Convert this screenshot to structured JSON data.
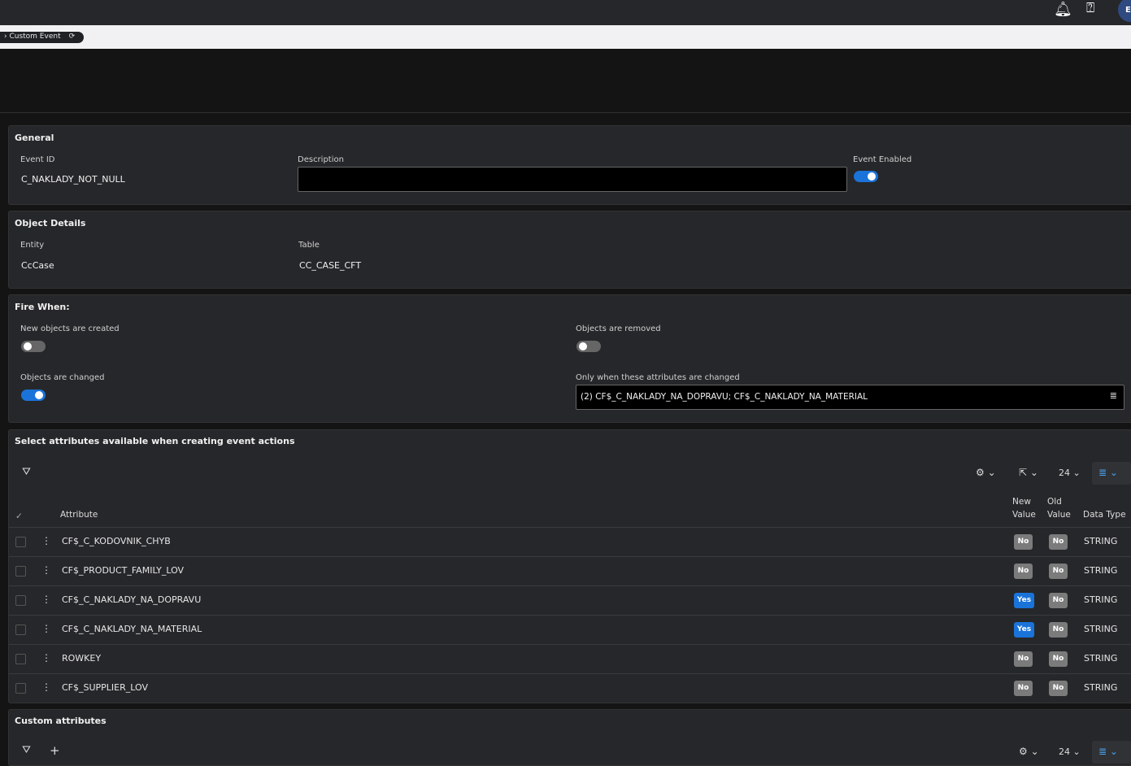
{
  "header": {
    "bell_icon": "bell-icon",
    "help_icon": "help-icon",
    "avatar_initial": "E"
  },
  "breadcrumb": {
    "label": "Custom Event"
  },
  "general": {
    "title": "General",
    "event_id_label": "Event ID",
    "event_id": "C_NAKLADY_NOT_NULL",
    "description_label": "Description",
    "description": "",
    "enabled_label": "Event Enabled",
    "enabled": true
  },
  "object_details": {
    "title": "Object Details",
    "entity_label": "Entity",
    "entity": "CcCase",
    "table_label": "Table",
    "table": "CC_CASE_CFT"
  },
  "fire_when": {
    "title": "Fire When:",
    "created_label": "New objects are created",
    "created": false,
    "removed_label": "Objects are removed",
    "removed": false,
    "changed_label": "Objects are changed",
    "changed": true,
    "only_when_label": "Only when these attributes are changed",
    "only_when_value": "(2) CF$_C_NAKLADY_NA_DOPRAVU; CF$_C_NAKLADY_NA_MATERIAL"
  },
  "attributes": {
    "title": "Select attributes available when creating event actions",
    "page_size": "24",
    "columns": {
      "attribute": "Attribute",
      "new_value": "New Value",
      "old_value": "Old Value",
      "data_type": "Data Type"
    },
    "rows": [
      {
        "name": "CF$_C_KODOVNIK_CHYB",
        "new": "No",
        "old": "No",
        "type": "STRING"
      },
      {
        "name": "CF$_PRODUCT_FAMILY_LOV",
        "new": "No",
        "old": "No",
        "type": "STRING"
      },
      {
        "name": "CF$_C_NAKLADY_NA_DOPRAVU",
        "new": "Yes",
        "old": "No",
        "type": "STRING"
      },
      {
        "name": "CF$_C_NAKLADY_NA_MATERIAL",
        "new": "Yes",
        "old": "No",
        "type": "STRING"
      },
      {
        "name": "ROWKEY",
        "new": "No",
        "old": "No",
        "type": "STRING"
      },
      {
        "name": "CF$_SUPPLIER_LOV",
        "new": "No",
        "old": "No",
        "type": "STRING"
      }
    ]
  },
  "custom": {
    "title": "Custom attributes",
    "page_size": "24"
  },
  "colors": {
    "accent": "#1a73d9",
    "panel": "#26272a",
    "background": "#141414"
  }
}
